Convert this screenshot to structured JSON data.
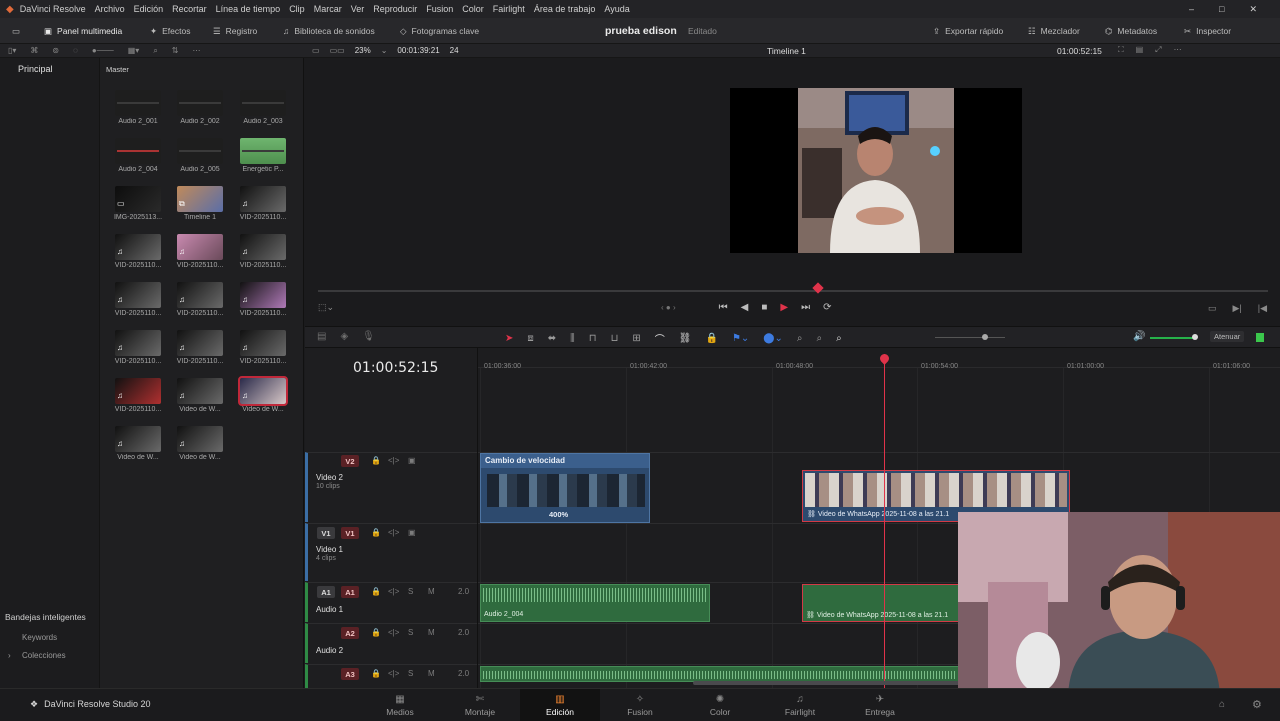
{
  "menu": [
    "Archivo",
    "Edición",
    "Recortar",
    "Línea de tiempo",
    "Clip",
    "Marcar",
    "Ver",
    "Reproducir",
    "Fusion",
    "Color",
    "Fairlight",
    "Área de trabajo",
    "Ayuda"
  ],
  "app_name": "DaVinci Resolve",
  "toolbar": {
    "media_pool": "Panel multimedia",
    "effects": "Efectos",
    "index": "Registro",
    "sound_library": "Biblioteca de sonidos",
    "keyframes": "Fotogramas clave",
    "project_title": "prueba edison",
    "project_status": "Editado",
    "quick_export": "Exportar rápido",
    "mixer": "Mezclador",
    "metadata": "Metadatos",
    "inspector": "Inspector"
  },
  "viewer_bar": {
    "zoom": "23%",
    "source_tc": "00:01:39:21",
    "fps": "24",
    "timeline_name": "Timeline 1",
    "record_tc": "01:00:52:15"
  },
  "media_pool": {
    "bin_root": "Principal",
    "bin_title": "Master",
    "smart_bins": "Bandejas inteligentes",
    "smart_items": [
      "Keywords",
      "Colecciones"
    ],
    "clips": [
      {
        "label": "Audio 2_001",
        "type": "audio"
      },
      {
        "label": "Audio 2_002",
        "type": "audio"
      },
      {
        "label": "Audio 2_003",
        "type": "audio"
      },
      {
        "label": "Audio 2_004",
        "type": "audio-red"
      },
      {
        "label": "Audio 2_005",
        "type": "audio"
      },
      {
        "label": "Energetic P...",
        "type": "audio-green"
      },
      {
        "label": "IMG-2025113...",
        "type": "image"
      },
      {
        "label": "Timeline 1",
        "type": "timeline"
      },
      {
        "label": "VID-2025110...",
        "type": "video"
      },
      {
        "label": "VID-2025110...",
        "type": "video"
      },
      {
        "label": "VID-2025110...",
        "type": "video-pink"
      },
      {
        "label": "VID-2025110...",
        "type": "video"
      },
      {
        "label": "VID-2025110...",
        "type": "video"
      },
      {
        "label": "VID-2025110...",
        "type": "video"
      },
      {
        "label": "VID-2025110...",
        "type": "video-purple"
      },
      {
        "label": "VID-2025110...",
        "type": "video"
      },
      {
        "label": "VID-2025110...",
        "type": "video"
      },
      {
        "label": "VID-2025110...",
        "type": "video"
      },
      {
        "label": "VID-2025110...",
        "type": "video-red"
      },
      {
        "label": "Video de W...",
        "type": "video"
      },
      {
        "label": "Video de W...",
        "type": "video-selected"
      },
      {
        "label": "Video de W...",
        "type": "video"
      },
      {
        "label": "Video de W...",
        "type": "video"
      }
    ]
  },
  "timeline": {
    "timecode": "01:00:52:15",
    "ruler": [
      "01:00:36:00",
      "01:00:42:00",
      "01:00:48:00",
      "01:00:54:00",
      "01:01:00:00",
      "01:01:06:00"
    ],
    "tracks": [
      {
        "badge": "V2",
        "name": "Video 2",
        "sub": "10 clips"
      },
      {
        "badge": "V1",
        "name": "Video 1",
        "sub": "4 clips"
      },
      {
        "badge": "A1",
        "name": "Audio 1",
        "sub": "",
        "level": "2.0"
      },
      {
        "badge": "A2",
        "name": "Audio 2",
        "sub": "",
        "level": "2.0"
      },
      {
        "badge": "A3",
        "name": "",
        "sub": "",
        "level": "2.0"
      }
    ],
    "clips": {
      "speed_title": "Cambio de velocidad",
      "speed_pct": "400%",
      "wa_video": "Video de WhatsApp 2025-11-08 a las 21.1",
      "audio_clip": "Audio 2_004",
      "wa_audio": "Video de WhatsApp 2025-11-08 a las 21.1"
    },
    "attenuate": "Atenuar"
  },
  "pages": [
    "Medios",
    "Montaje",
    "Edición",
    "Fusion",
    "Color",
    "Fairlight",
    "Entrega"
  ],
  "active_page": "Edición",
  "brand": "DaVinci Resolve Studio 20"
}
